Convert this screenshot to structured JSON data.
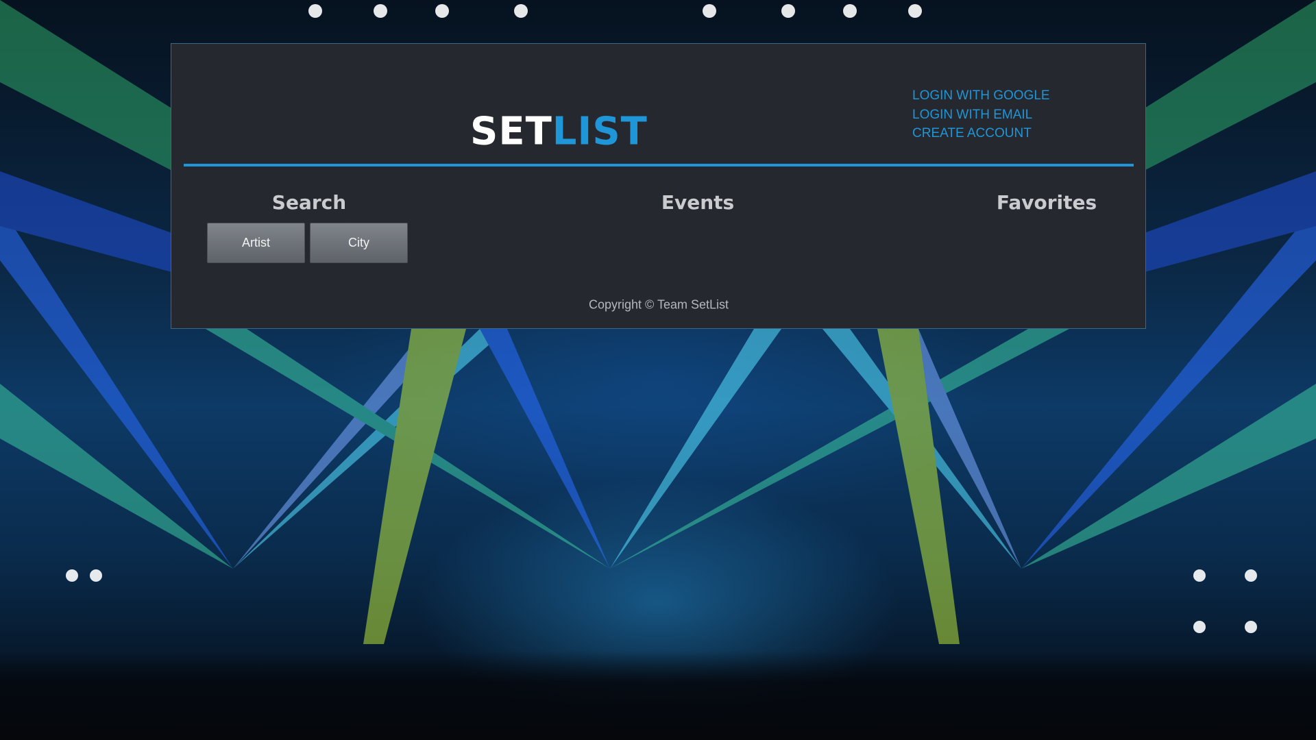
{
  "header": {
    "logo_part1": "SET",
    "logo_part2": "LIST",
    "auth_links": [
      "LOGIN WITH GOOGLE",
      "LOGIN WITH EMAIL",
      "CREATE ACCOUNT"
    ]
  },
  "nav": {
    "search_heading": "Search",
    "events_heading": "Events",
    "favorites_heading": "Favorites"
  },
  "search": {
    "artist_button": "Artist",
    "city_button": "City"
  },
  "footer": {
    "copyright": "Copyright © Team SetList"
  },
  "colors": {
    "accent": "#1e96d8",
    "panel_background": "#25282e",
    "logo_white": "#ffffff",
    "button_gray": "#6e7379"
  }
}
